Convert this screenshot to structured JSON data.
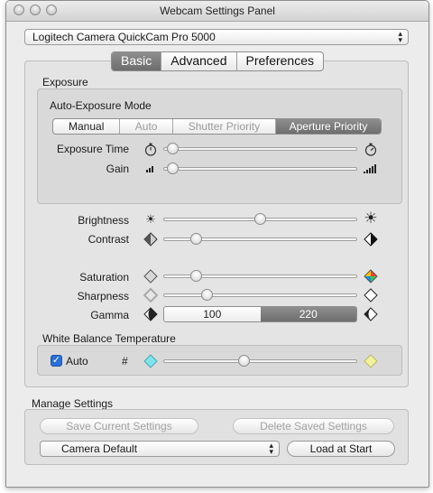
{
  "window": {
    "title": "Webcam Settings Panel"
  },
  "camera": {
    "selected": "Logitech Camera QuickCam Pro 5000"
  },
  "tabs": [
    {
      "label": "Basic",
      "active": true
    },
    {
      "label": "Advanced",
      "active": false
    },
    {
      "label": "Preferences",
      "active": false
    }
  ],
  "exposure": {
    "heading": "Exposure",
    "mode_heading": "Auto-Exposure Mode",
    "modes": [
      {
        "label": "Manual",
        "state": "normal"
      },
      {
        "label": "Auto",
        "state": "disabled"
      },
      {
        "label": "Shutter Priority",
        "state": "disabled"
      },
      {
        "label": "Aperture Priority",
        "state": "selected"
      }
    ],
    "exposure_time": {
      "label": "Exposure Time",
      "value": 0.02
    },
    "gain": {
      "label": "Gain",
      "value": 0.02
    }
  },
  "image": {
    "brightness": {
      "label": "Brightness",
      "value": 0.5
    },
    "contrast": {
      "label": "Contrast",
      "value": 0.15
    },
    "saturation": {
      "label": "Saturation",
      "value": 0.15
    },
    "sharpness": {
      "label": "Sharpness",
      "value": 0.21
    },
    "gamma": {
      "label": "Gamma",
      "values": [
        "100",
        "220"
      ],
      "selected": "220"
    }
  },
  "white_balance": {
    "heading": "White Balance Temperature",
    "auto_label": "Auto",
    "auto_checked": true,
    "hash_label": "#",
    "value": 0.41
  },
  "manage": {
    "heading": "Manage Settings",
    "save_label": "Save Current Settings",
    "delete_label": "Delete Saved Settings",
    "preset": "Camera Default",
    "load_label": "Load at Start"
  },
  "colors": {
    "selected_segment": "#7a7a7a",
    "checkbox": "#2a6fd6"
  }
}
